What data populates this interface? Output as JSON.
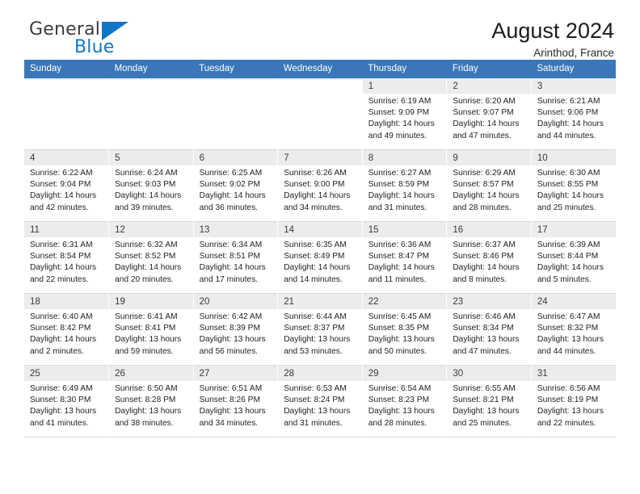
{
  "brand": {
    "name_part1": "General",
    "name_part2": "Blue",
    "triangle_color": "#1175c7"
  },
  "header": {
    "title": "August 2024",
    "subtitle": "Arinthod, France"
  },
  "theme": {
    "header_row_bg": "#3a76b8",
    "header_row_text": "#ffffff",
    "daynum_bg": "#ececec",
    "grid_line": "#d8d8d8"
  },
  "weekdays": [
    "Sunday",
    "Monday",
    "Tuesday",
    "Wednesday",
    "Thursday",
    "Friday",
    "Saturday"
  ],
  "calendar": {
    "month": "August",
    "year": "2024",
    "location": "Arinthod, France",
    "weeks": [
      [
        {
          "day": "",
          "empty": true
        },
        {
          "day": "",
          "empty": true
        },
        {
          "day": "",
          "empty": true
        },
        {
          "day": "",
          "empty": true
        },
        {
          "day": "1",
          "sunrise": "Sunrise: 6:19 AM",
          "sunset": "Sunset: 9:09 PM",
          "daylight1": "Daylight: 14 hours",
          "daylight2": "and 49 minutes."
        },
        {
          "day": "2",
          "sunrise": "Sunrise: 6:20 AM",
          "sunset": "Sunset: 9:07 PM",
          "daylight1": "Daylight: 14 hours",
          "daylight2": "and 47 minutes."
        },
        {
          "day": "3",
          "sunrise": "Sunrise: 6:21 AM",
          "sunset": "Sunset: 9:06 PM",
          "daylight1": "Daylight: 14 hours",
          "daylight2": "and 44 minutes."
        }
      ],
      [
        {
          "day": "4",
          "sunrise": "Sunrise: 6:22 AM",
          "sunset": "Sunset: 9:04 PM",
          "daylight1": "Daylight: 14 hours",
          "daylight2": "and 42 minutes."
        },
        {
          "day": "5",
          "sunrise": "Sunrise: 6:24 AM",
          "sunset": "Sunset: 9:03 PM",
          "daylight1": "Daylight: 14 hours",
          "daylight2": "and 39 minutes."
        },
        {
          "day": "6",
          "sunrise": "Sunrise: 6:25 AM",
          "sunset": "Sunset: 9:02 PM",
          "daylight1": "Daylight: 14 hours",
          "daylight2": "and 36 minutes."
        },
        {
          "day": "7",
          "sunrise": "Sunrise: 6:26 AM",
          "sunset": "Sunset: 9:00 PM",
          "daylight1": "Daylight: 14 hours",
          "daylight2": "and 34 minutes."
        },
        {
          "day": "8",
          "sunrise": "Sunrise: 6:27 AM",
          "sunset": "Sunset: 8:59 PM",
          "daylight1": "Daylight: 14 hours",
          "daylight2": "and 31 minutes."
        },
        {
          "day": "9",
          "sunrise": "Sunrise: 6:29 AM",
          "sunset": "Sunset: 8:57 PM",
          "daylight1": "Daylight: 14 hours",
          "daylight2": "and 28 minutes."
        },
        {
          "day": "10",
          "sunrise": "Sunrise: 6:30 AM",
          "sunset": "Sunset: 8:55 PM",
          "daylight1": "Daylight: 14 hours",
          "daylight2": "and 25 minutes."
        }
      ],
      [
        {
          "day": "11",
          "sunrise": "Sunrise: 6:31 AM",
          "sunset": "Sunset: 8:54 PM",
          "daylight1": "Daylight: 14 hours",
          "daylight2": "and 22 minutes."
        },
        {
          "day": "12",
          "sunrise": "Sunrise: 6:32 AM",
          "sunset": "Sunset: 8:52 PM",
          "daylight1": "Daylight: 14 hours",
          "daylight2": "and 20 minutes."
        },
        {
          "day": "13",
          "sunrise": "Sunrise: 6:34 AM",
          "sunset": "Sunset: 8:51 PM",
          "daylight1": "Daylight: 14 hours",
          "daylight2": "and 17 minutes."
        },
        {
          "day": "14",
          "sunrise": "Sunrise: 6:35 AM",
          "sunset": "Sunset: 8:49 PM",
          "daylight1": "Daylight: 14 hours",
          "daylight2": "and 14 minutes."
        },
        {
          "day": "15",
          "sunrise": "Sunrise: 6:36 AM",
          "sunset": "Sunset: 8:47 PM",
          "daylight1": "Daylight: 14 hours",
          "daylight2": "and 11 minutes."
        },
        {
          "day": "16",
          "sunrise": "Sunrise: 6:37 AM",
          "sunset": "Sunset: 8:46 PM",
          "daylight1": "Daylight: 14 hours",
          "daylight2": "and 8 minutes."
        },
        {
          "day": "17",
          "sunrise": "Sunrise: 6:39 AM",
          "sunset": "Sunset: 8:44 PM",
          "daylight1": "Daylight: 14 hours",
          "daylight2": "and 5 minutes."
        }
      ],
      [
        {
          "day": "18",
          "sunrise": "Sunrise: 6:40 AM",
          "sunset": "Sunset: 8:42 PM",
          "daylight1": "Daylight: 14 hours",
          "daylight2": "and 2 minutes."
        },
        {
          "day": "19",
          "sunrise": "Sunrise: 6:41 AM",
          "sunset": "Sunset: 8:41 PM",
          "daylight1": "Daylight: 13 hours",
          "daylight2": "and 59 minutes."
        },
        {
          "day": "20",
          "sunrise": "Sunrise: 6:42 AM",
          "sunset": "Sunset: 8:39 PM",
          "daylight1": "Daylight: 13 hours",
          "daylight2": "and 56 minutes."
        },
        {
          "day": "21",
          "sunrise": "Sunrise: 6:44 AM",
          "sunset": "Sunset: 8:37 PM",
          "daylight1": "Daylight: 13 hours",
          "daylight2": "and 53 minutes."
        },
        {
          "day": "22",
          "sunrise": "Sunrise: 6:45 AM",
          "sunset": "Sunset: 8:35 PM",
          "daylight1": "Daylight: 13 hours",
          "daylight2": "and 50 minutes."
        },
        {
          "day": "23",
          "sunrise": "Sunrise: 6:46 AM",
          "sunset": "Sunset: 8:34 PM",
          "daylight1": "Daylight: 13 hours",
          "daylight2": "and 47 minutes."
        },
        {
          "day": "24",
          "sunrise": "Sunrise: 6:47 AM",
          "sunset": "Sunset: 8:32 PM",
          "daylight1": "Daylight: 13 hours",
          "daylight2": "and 44 minutes."
        }
      ],
      [
        {
          "day": "25",
          "sunrise": "Sunrise: 6:49 AM",
          "sunset": "Sunset: 8:30 PM",
          "daylight1": "Daylight: 13 hours",
          "daylight2": "and 41 minutes."
        },
        {
          "day": "26",
          "sunrise": "Sunrise: 6:50 AM",
          "sunset": "Sunset: 8:28 PM",
          "daylight1": "Daylight: 13 hours",
          "daylight2": "and 38 minutes."
        },
        {
          "day": "27",
          "sunrise": "Sunrise: 6:51 AM",
          "sunset": "Sunset: 8:26 PM",
          "daylight1": "Daylight: 13 hours",
          "daylight2": "and 34 minutes."
        },
        {
          "day": "28",
          "sunrise": "Sunrise: 6:53 AM",
          "sunset": "Sunset: 8:24 PM",
          "daylight1": "Daylight: 13 hours",
          "daylight2": "and 31 minutes."
        },
        {
          "day": "29",
          "sunrise": "Sunrise: 6:54 AM",
          "sunset": "Sunset: 8:23 PM",
          "daylight1": "Daylight: 13 hours",
          "daylight2": "and 28 minutes."
        },
        {
          "day": "30",
          "sunrise": "Sunrise: 6:55 AM",
          "sunset": "Sunset: 8:21 PM",
          "daylight1": "Daylight: 13 hours",
          "daylight2": "and 25 minutes."
        },
        {
          "day": "31",
          "sunrise": "Sunrise: 6:56 AM",
          "sunset": "Sunset: 8:19 PM",
          "daylight1": "Daylight: 13 hours",
          "daylight2": "and 22 minutes."
        }
      ]
    ]
  }
}
